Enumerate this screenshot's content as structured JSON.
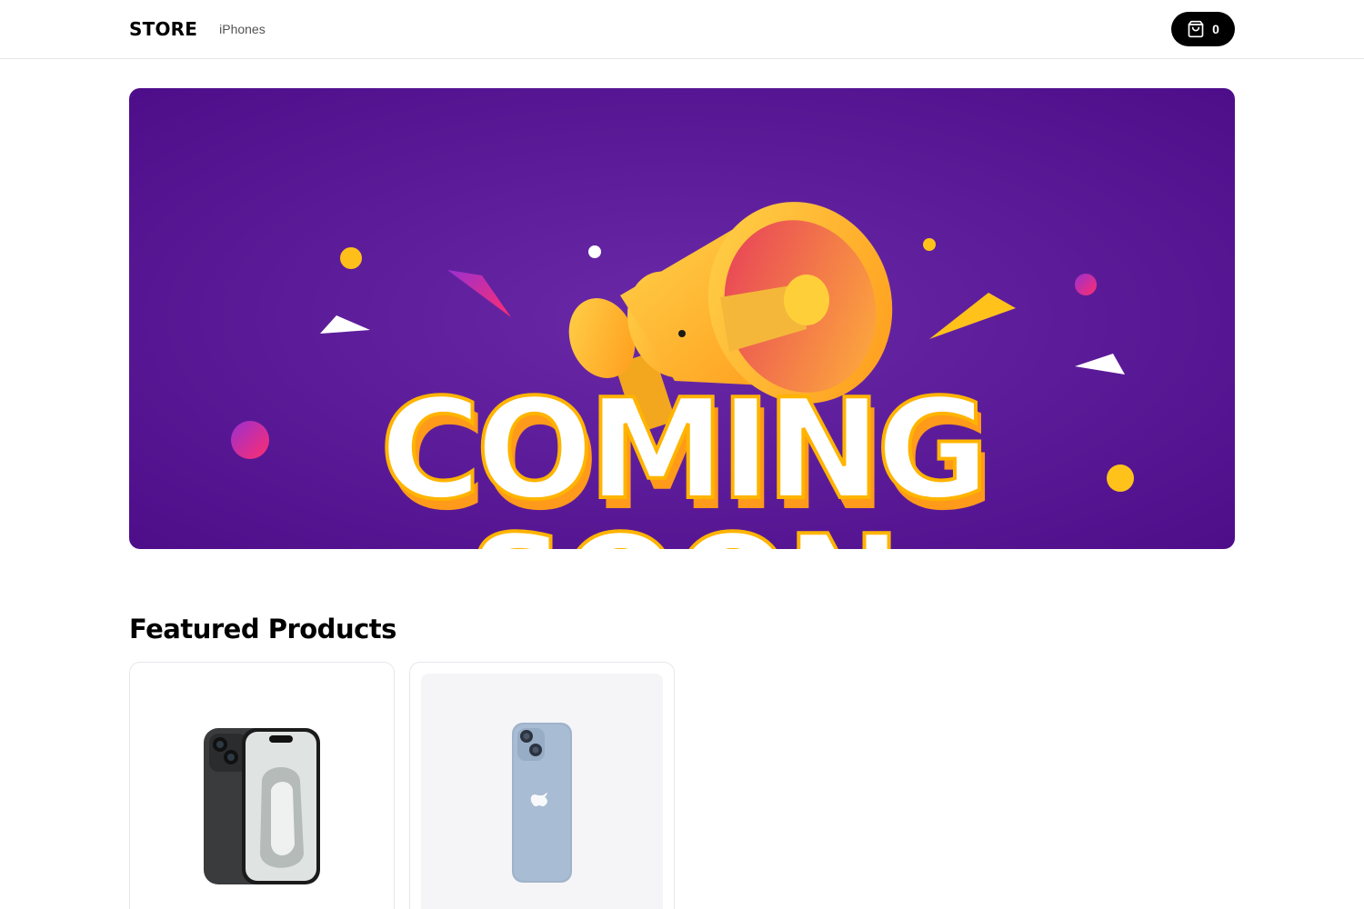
{
  "nav": {
    "logo": "STORE",
    "links": [
      {
        "label": "iPhones"
      }
    ],
    "cart": {
      "count": "0",
      "icon": "shopping-bag-icon"
    }
  },
  "hero": {
    "line1": "COMING",
    "line2": "SOON",
    "colors": {
      "background": "#5b1a9a",
      "accent": "#ffb400"
    }
  },
  "featured": {
    "title": "Featured Products",
    "products": [
      {
        "image": "iphone-15-black"
      },
      {
        "image": "iphone-14-blue"
      }
    ]
  }
}
